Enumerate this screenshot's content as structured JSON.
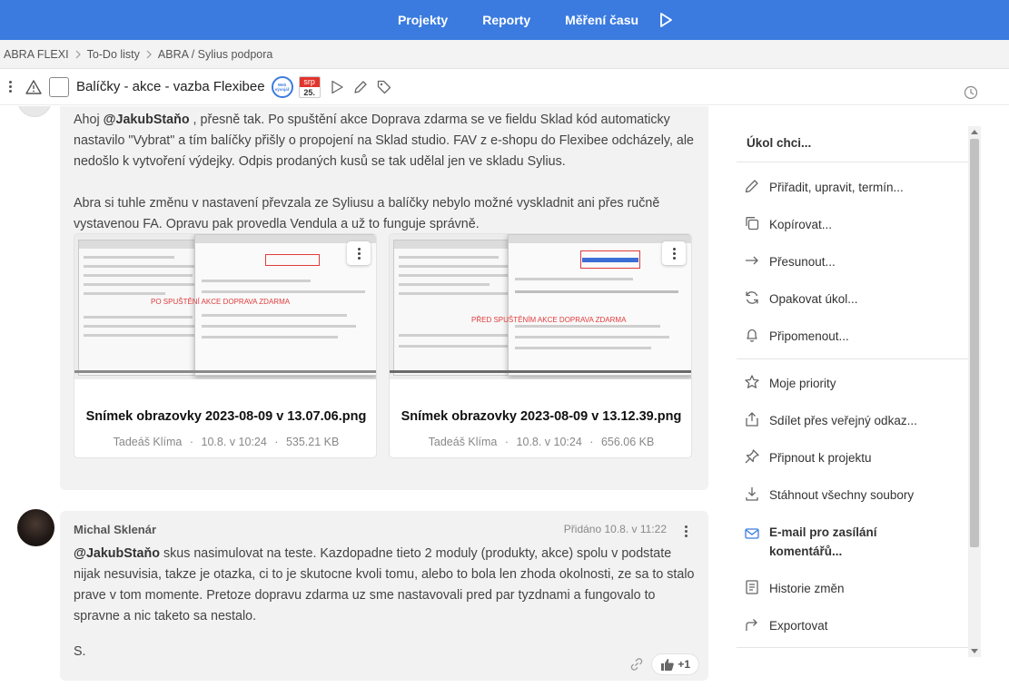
{
  "topnav": {
    "items": [
      {
        "label": "Projekty"
      },
      {
        "label": "Reporty"
      },
      {
        "label": "Měření času"
      }
    ],
    "accent": "#3b7be0"
  },
  "breadcrumb": {
    "items": [
      "ABRA FLEXI",
      "To-Do listy",
      "ABRA / Sylius podpora"
    ]
  },
  "task": {
    "title": "Balíčky - akce - vazba Flexibee",
    "date_month": "srp",
    "date_day": "25.",
    "assignee_badge": "Web vývojář"
  },
  "comment1": {
    "mention": "@JakubStaňo",
    "paragraph1_lead": "Ahoj ",
    "paragraph1_rest": " , přesně tak. Po spuštění akce Doprava zdarma se ve fieldu Sklad kód automaticky nastavilo \"Vybrat\" a tím balíčky přišly o propojení na Sklad studio. FAV z e-shopu do Flexibee odcházely, ale nedošlo k vytvoření výdejky. Odpis prodaných kusů se tak udělal jen ve skladu Sylius.",
    "paragraph2": "Abra si tuhle změnu v nastavení převzala ze Syliusu a balíčky nebylo možné vyskladnit ani přes ručně vystavenou FA. Opravu pak provedla Vendula a už to funguje správně.",
    "attachments": [
      {
        "filename": "Snímek obrazovky 2023-08-09 v 13.07.06.png",
        "author": "Tadeáš Klíma",
        "date": "10.8. v 10:24",
        "size": "535.21 KB",
        "overlay_text": "PO SPUŠTĚNÍ AKCE DOPRAVA ZDARMA"
      },
      {
        "filename": "Snímek obrazovky 2023-08-09 v 13.12.39.png",
        "author": "Tadeáš Klíma",
        "date": "10.8. v 10:24",
        "size": "656.06 KB",
        "overlay_text": "PŘED SPUŠTĚNÍM AKCE DOPRAVA ZDARMA"
      }
    ],
    "meta_sep": "·"
  },
  "comment2": {
    "author": "Michal Sklenár",
    "date": "Přidáno 10.8. v 11:22",
    "mention": "@JakubStaňo",
    "body": " skus nasimulovat na teste. Kazdopadne tieto 2 moduly (produkty, akce) spolu v podstate nijak nesuvisia, takze je otazka, ci to je skutocne kvoli tomu, alebo to bola len zhoda okolnosti, ze sa to stalo prave v tom momente. Pretoze dopravu zdarma uz sme nastavovali pred par tyzdnami a fungovalo to spravne a nic taketo sa nestalo.",
    "signature": "S.",
    "likes": "+1"
  },
  "side_menu": {
    "title": "Úkol chci...",
    "items": [
      {
        "label": "Přiřadit, upravit, termín...",
        "icon": "pencil-icon"
      },
      {
        "label": "Kopírovat...",
        "icon": "copy-icon"
      },
      {
        "label": "Přesunout...",
        "icon": "arrow-right-icon"
      },
      {
        "label": "Opakovat úkol...",
        "icon": "repeat-icon"
      },
      {
        "label": "Připomenout...",
        "icon": "bell-icon"
      },
      {
        "label": "Moje priority",
        "icon": "star-icon"
      },
      {
        "label": "Sdílet přes veřejný odkaz...",
        "icon": "share-icon"
      },
      {
        "label": "Připnout k projektu",
        "icon": "pin-icon"
      },
      {
        "label": "Stáhnout všechny soubory",
        "icon": "download-icon"
      },
      {
        "label": "E-mail pro zasílání komentářů...",
        "icon": "email-icon"
      },
      {
        "label": "Historie změn",
        "icon": "history-list-icon"
      },
      {
        "label": "Exportovat",
        "icon": "export-icon"
      }
    ]
  }
}
